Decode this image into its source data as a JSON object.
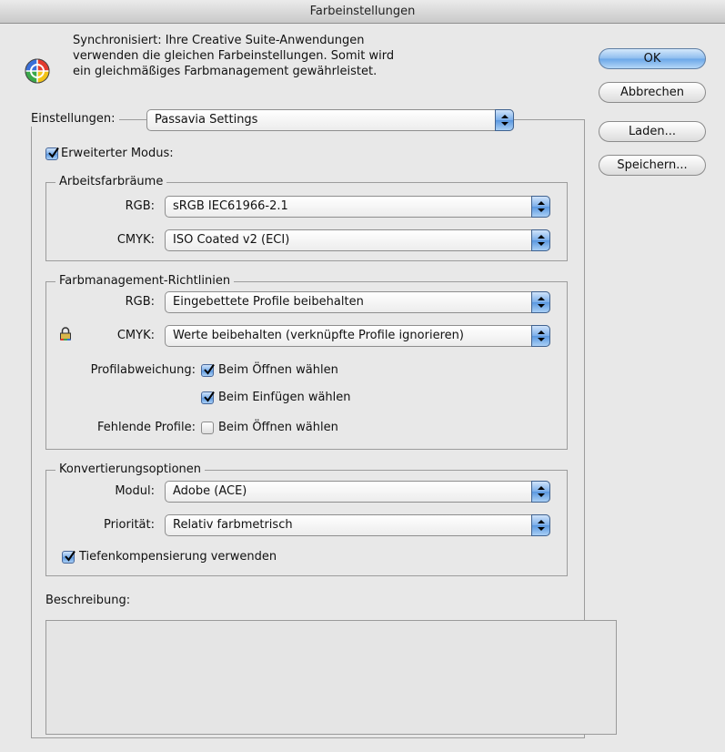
{
  "window": {
    "title": "Farbeinstellungen"
  },
  "sync": {
    "line1": "Synchronisiert: Ihre Creative Suite-Anwendungen",
    "line2": "verwenden die gleichen Farbeinstellungen. Somit wird",
    "line3": "ein gleichmäßiges Farbmanagement gewährleistet.",
    "icon": "color-wheel-icon"
  },
  "buttons": {
    "ok": "OK",
    "cancel": "Abbrechen",
    "load": "Laden...",
    "save": "Speichern..."
  },
  "settings": {
    "label": "Einstellungen:",
    "value": "Passavia Settings",
    "advanced_mode": {
      "label": "Erweiterter Modus:",
      "checked": true
    }
  },
  "working_spaces": {
    "title": "Arbeitsfarbräume",
    "rgb": {
      "label": "RGB:",
      "value": "sRGB IEC61966-2.1"
    },
    "cmyk": {
      "label": "CMYK:",
      "value": "ISO Coated v2 (ECI)"
    }
  },
  "policies": {
    "title": "Farbmanagement-Richtlinien",
    "rgb": {
      "label": "RGB:",
      "value": "Eingebettete Profile beibehalten"
    },
    "cmyk": {
      "label": "CMYK:",
      "value": "Werte beibehalten (verknüpfte Profile ignorieren)",
      "lock_icon": "lock-icon"
    },
    "mismatch": {
      "label": "Profilabweichung:",
      "on_open": {
        "label": "Beim Öffnen wählen",
        "checked": true
      },
      "on_paste": {
        "label": "Beim Einfügen wählen",
        "checked": true
      }
    },
    "missing": {
      "label": "Fehlende Profile:",
      "on_open": {
        "label": "Beim Öffnen wählen",
        "checked": false
      }
    }
  },
  "conversion": {
    "title": "Konvertierungsoptionen",
    "engine": {
      "label": "Modul:",
      "value": "Adobe (ACE)"
    },
    "intent": {
      "label": "Priorität:",
      "value": "Relativ farbmetrisch"
    },
    "bpc": {
      "label": "Tiefenkompensierung verwenden",
      "checked": true
    }
  },
  "description": {
    "label": "Beschreibung:",
    "text": ""
  },
  "colors": {
    "accent": "#6aa6e8",
    "window_bg": "#e8e8e8"
  }
}
